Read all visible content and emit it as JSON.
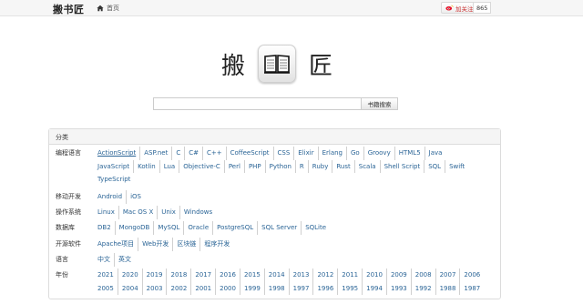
{
  "topbar": {
    "brand": "搬书匠",
    "home_label": "首页",
    "weibo_label": "加关注",
    "weibo_count": "865"
  },
  "logo": {
    "left_char": "搬",
    "right_char": "匠"
  },
  "search": {
    "button_label": "书籍搜索",
    "value": ""
  },
  "panel": {
    "title": "分类",
    "rows": [
      {
        "label": "编程语言",
        "top": 0,
        "items": [
          "ActionScript",
          "ASP.net",
          "C",
          "C#",
          "C++",
          "CoffeeScript",
          "CSS",
          "Elixir",
          "Erlang",
          "Go",
          "Groovy",
          "HTML5",
          "Java",
          "JavaScript",
          "Kotlin",
          "Lua",
          "Objective-C",
          "Perl",
          "PHP",
          "Python",
          "R",
          "Ruby",
          "Rust",
          "Scala",
          "Shell Script",
          "SQL",
          "Swift",
          "TypeScript"
        ]
      },
      {
        "label": "移动开发",
        "items": [
          "Android",
          "iOS"
        ]
      },
      {
        "label": "操作系统",
        "items": [
          "Linux",
          "Mac OS X",
          "Unix",
          "Windows"
        ]
      },
      {
        "label": "数据库",
        "items": [
          "DB2",
          "MongoDB",
          "MySQL",
          "Oracle",
          "PostgreSQL",
          "SQL Server",
          "SQLite"
        ]
      },
      {
        "label": "开源软件",
        "items": [
          "Apache项目",
          "Web开发",
          "区块链",
          "程序开发"
        ]
      },
      {
        "label": "语言",
        "items": [
          "中文",
          "英文"
        ]
      },
      {
        "label": "年份",
        "items": [
          "2021",
          "2020",
          "2019",
          "2018",
          "2017",
          "2016",
          "2015",
          "2014",
          "2013",
          "2012",
          "2011",
          "2010",
          "2009",
          "2008",
          "2007",
          "2006",
          "2005",
          "2004",
          "2003",
          "2002",
          "2001",
          "2000",
          "1999",
          "1998",
          "1997",
          "1996",
          "1995",
          "1994",
          "1993",
          "1992",
          "1988",
          "1987"
        ]
      }
    ]
  }
}
